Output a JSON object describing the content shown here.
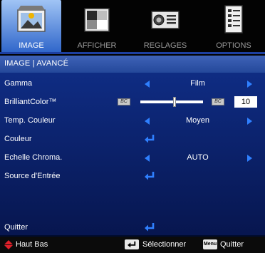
{
  "tabs": [
    {
      "label": "IMAGE",
      "icon": "image-icon",
      "active": true
    },
    {
      "label": "AFFICHER",
      "icon": "display-icon",
      "active": false
    },
    {
      "label": "REGLAGES",
      "icon": "projector-icon",
      "active": false
    },
    {
      "label": "OPTIONS",
      "icon": "options-icon",
      "active": false
    }
  ],
  "section_title": "IMAGE | AVANCÉ",
  "rows": {
    "gamma": {
      "label": "Gamma",
      "value": "Film"
    },
    "brilliant": {
      "label": "BrilliantColor™",
      "value": "10",
      "slider_fraction": 0.5
    },
    "temp": {
      "label": "Temp. Couleur",
      "value": "Moyen"
    },
    "couleur": {
      "label": "Couleur"
    },
    "echelle": {
      "label": "Echelle Chroma.",
      "value": "AUTO"
    },
    "source": {
      "label": "Source d'Entrée"
    },
    "quitter": {
      "label": "Quitter"
    }
  },
  "footer": {
    "nav_label": "Haut Bas",
    "select_label": "Sélectionner",
    "menu_key": "Menu",
    "quit_label": "Quitter"
  },
  "colors": {
    "accent_arrow": "#2f80ff",
    "nav_icon": "#e0202a",
    "active_tab": "#5b8fe0"
  }
}
